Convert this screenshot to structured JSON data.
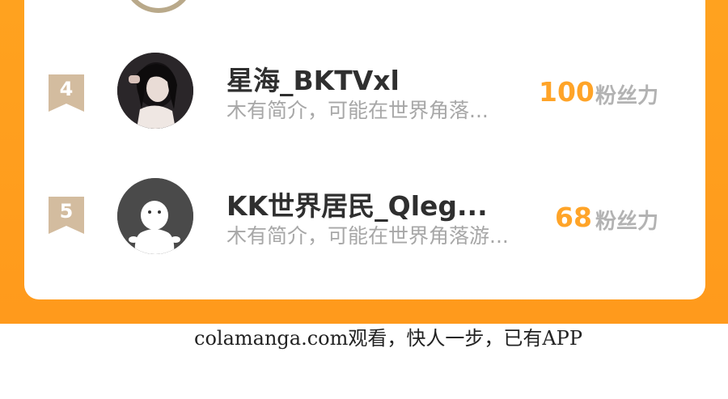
{
  "ranking": [
    {
      "rank": "4",
      "name": "星海_BKTVxl",
      "bio": "木有简介，可能在世界角落...",
      "score": "100",
      "unit": "粉丝力",
      "avatar_type": "photo"
    },
    {
      "rank": "5",
      "name": "KK世界居民_Qleg...",
      "bio": "木有简介，可能在世界角落游...",
      "score": "68",
      "unit": "粉丝力",
      "avatar_type": "default-avatar-icon"
    }
  ],
  "footer": {
    "watermark": "colamanga.com观看，快人一步，已有APP"
  },
  "colors": {
    "panel": "#ffa21f",
    "score": "#ffa428",
    "badge": "#d3bc9f"
  }
}
